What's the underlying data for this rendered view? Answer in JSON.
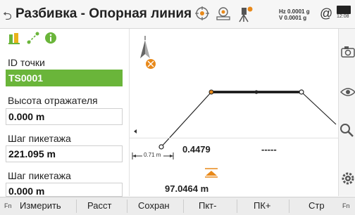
{
  "title_bar": {
    "back_symbol": "⮌",
    "title": "Разбивка - Опорная линия",
    "hz_line": "Hz 0.0001 g",
    "v_line": "V  0.0001 g",
    "at_symbol": "@",
    "time": "12:08"
  },
  "left_panel": {
    "fields": [
      {
        "label": "ID точки",
        "value": "TS0001"
      },
      {
        "label": "Высота отражателя",
        "value": "0.000 m"
      },
      {
        "label": "Шаг пикетажа",
        "value": "221.095 m"
      },
      {
        "label": "Шаг пикетажа",
        "value": "0.000 m"
      }
    ]
  },
  "graphic": {
    "distance_label": "0.71 m",
    "readout_top": "0.4479",
    "readout_dashes": "-----",
    "readout_bottom": "97.0464 m"
  },
  "bottom_bar": {
    "fn_left": "Fn",
    "buttons": [
      "Измерить",
      "Расст",
      "Сохран",
      "Пкт-",
      "ПК+",
      "Стр"
    ],
    "fn_right": "Fn"
  },
  "colors": {
    "accent_green": "#6ab53a",
    "marker_orange": "#e8891a"
  }
}
